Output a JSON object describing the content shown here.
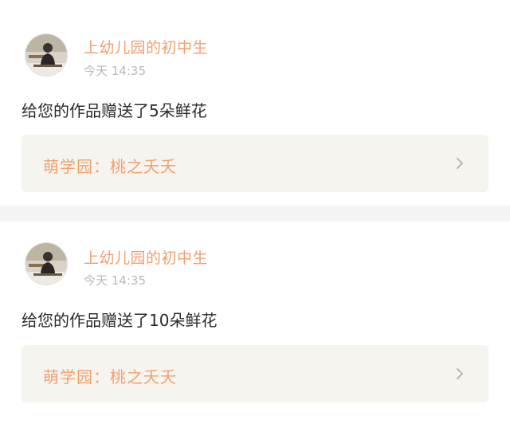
{
  "notifications": [
    {
      "user_name": "上幼儿园的初中生",
      "time": "今天 14:35",
      "message": "给您的作品赠送了5朵鲜花",
      "work_title": "萌学园：桃之夭夭",
      "avatar": "avatar-photo",
      "link_icon": "chevron-right-icon"
    },
    {
      "user_name": "上幼儿园的初中生",
      "time": "今天 14:35",
      "message": "给您的作品赠送了10朵鲜花",
      "work_title": "萌学园：桃之夭夭",
      "avatar": "avatar-photo",
      "link_icon": "chevron-right-icon"
    }
  ],
  "colors": {
    "accent": "#f0a070",
    "tab_indicator": "#e06a93",
    "link_bg": "#f5f4ef",
    "page_bg": "#f4f4f4"
  }
}
